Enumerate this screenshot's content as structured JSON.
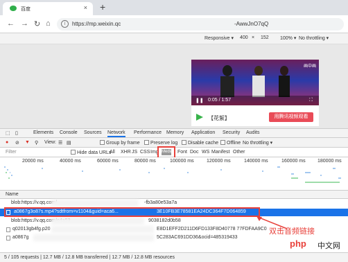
{
  "browser": {
    "tab_title": "百度",
    "tab_close": "×",
    "new_tab": "+",
    "url": "https://mp.weixin.qc",
    "url_tail": "-AwwJnO7qQ"
  },
  "emulation": {
    "device": "Responsive ▾",
    "width": "400",
    "times": "×",
    "height": "152",
    "zoom": "100% ▾",
    "throttle": "No throttling ▾"
  },
  "video": {
    "pip": "画中画",
    "time": "0:05 / 1:57",
    "label": "【花絮】",
    "cta": "用腾讯视频观看"
  },
  "devtools": {
    "tabs": [
      "Elements",
      "Console",
      "Sources",
      "Network",
      "Performance",
      "Memory",
      "Application",
      "Security",
      "Audits"
    ],
    "view_label": "View:",
    "group_by_frame": "Group by frame",
    "preserve_log": "Preserve log",
    "disable_cache": "Disable cache",
    "offline": "Offline",
    "throttle": "No throttling ▾",
    "filter_placeholder": "Filter",
    "hide_data_urls": "Hide data URLs",
    "filter_types": [
      "All",
      "XHR",
      "JS",
      "CSS",
      "Img",
      "Media",
      "Font",
      "Doc",
      "WS",
      "Manifest",
      "Other"
    ],
    "timeline_ticks": [
      "20000 ms",
      "40000 ms",
      "60000 ms",
      "80000 ms",
      "100000 ms",
      "120000 ms",
      "140000 ms",
      "160000 ms",
      "180000 ms"
    ],
    "col_name": "Name",
    "rows": [
      {
        "name": "blob:https://v.qq.com/...",
        "right": "-fb3a80e53a7a",
        "selected": false
      },
      {
        "name": "a0867g3o87s.mp4?sdtfrom=v1104&guid=aca6...",
        "right": "3E10FB3E78581EA24DC364F7D064859",
        "selected": true
      },
      {
        "name": "blob:https://v.qq.com/e4a53",
        "right": "9038182d0b58",
        "selected": false
      },
      {
        "name": "q02013gb4fg.p20",
        "right": "E8D1EFF2D211D6FD133F8D40778 77FDFAA9C0",
        "selected": false
      },
      {
        "name": "a0867g",
        "right": "5C283AC691DD36&ocid=485319433",
        "selected": false
      }
    ],
    "status": "5 / 105 requests | 12.7 MB / 12.8 MB transferred | 12.7 MB / 12.8 MB resources"
  },
  "annotation": "双击音频链接",
  "watermark": {
    "logo": "php",
    "text": "中文网"
  }
}
